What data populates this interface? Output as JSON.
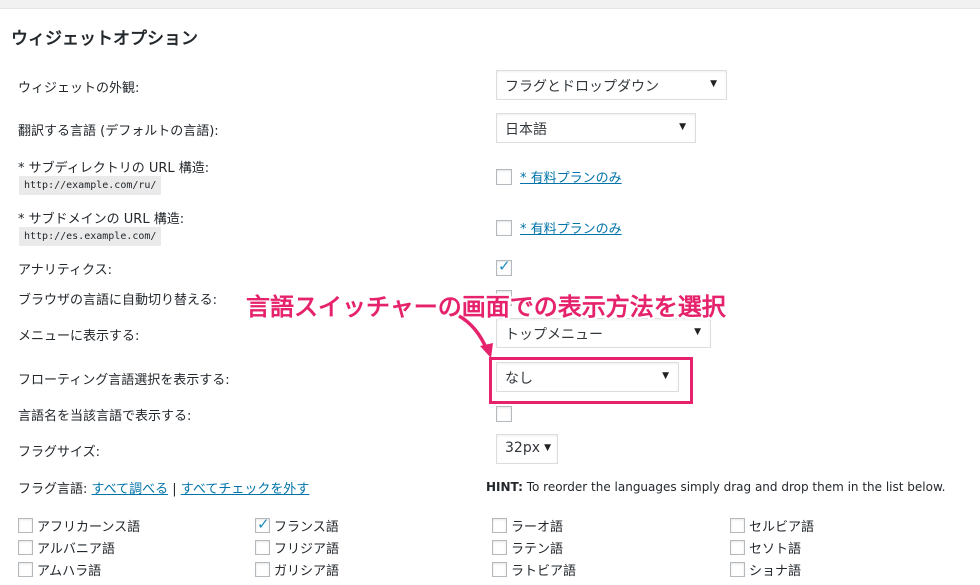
{
  "section_title": "ウィジェットオプション",
  "fields": {
    "appearance": {
      "label": "ウィジェットの外観:",
      "value": "フラグとドロップダウン"
    },
    "default_language": {
      "label": "翻訳する言語 (デフォルトの言語):",
      "value": "日本語"
    },
    "subdirectory": {
      "label": "* サブディレクトリの URL 構造:",
      "example": "http://example.com/ru/",
      "link": "* 有料プランのみ"
    },
    "subdomain": {
      "label": "* サブドメインの URL 構造:",
      "example": "http://es.example.com/",
      "link": "* 有料プランのみ"
    },
    "analytics": {
      "label": "アナリティクス:",
      "checked": true
    },
    "auto_switch": {
      "label": "ブラウザの言語に自動切り替える:"
    },
    "show_in_menu": {
      "label": "メニューに表示する:",
      "value": "トップメニュー"
    },
    "floating": {
      "label": "フローティング言語選択を表示する:",
      "value": "なし"
    },
    "native_names": {
      "label": "言語名を当該言語で表示する:",
      "checked": false
    },
    "flag_size": {
      "label": "フラグサイズ:",
      "value": "32px"
    },
    "flag_languages": {
      "label": "フラグ言語:",
      "check_all": "すべて調べる",
      "separator": "|",
      "uncheck_all": "すべてチェックを外す"
    }
  },
  "hint": {
    "bold": "HINT:",
    "text": " To reorder the languages simply drag and drop them in the list below."
  },
  "languages": [
    [
      {
        "name": "アフリカーンス語",
        "checked": false
      },
      {
        "name": "フランス語",
        "checked": true
      },
      {
        "name": "ラーオ語",
        "checked": false
      },
      {
        "name": "セルビア語",
        "checked": false
      }
    ],
    [
      {
        "name": "アルバニア語",
        "checked": false
      },
      {
        "name": "フリジア語",
        "checked": false
      },
      {
        "name": "ラテン語",
        "checked": false
      },
      {
        "name": "セソト語",
        "checked": false
      }
    ],
    [
      {
        "name": "アムハラ語",
        "checked": false
      },
      {
        "name": "ガリシア語",
        "checked": false
      },
      {
        "name": "ラトビア語",
        "checked": false
      },
      {
        "name": "ショナ語",
        "checked": false
      }
    ]
  ],
  "annotation": {
    "callout": "言語スイッチャーの画面での表示方法を選択",
    "color": "#e5226b"
  },
  "colors": {
    "link": "#0073aa",
    "check": "#1e8cbe"
  }
}
